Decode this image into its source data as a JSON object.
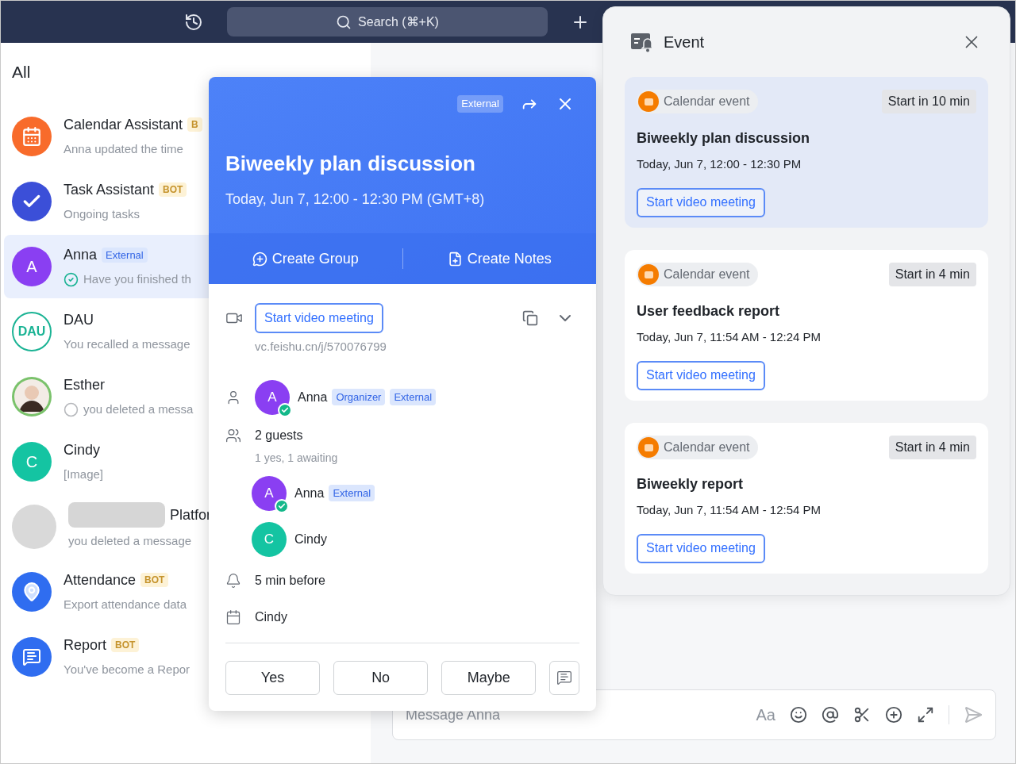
{
  "topbar": {
    "search": {
      "placeholder": "Search (⌘+K)"
    }
  },
  "sidebar": {
    "title": "All",
    "chats": [
      {
        "name": "Calendar Assistant",
        "badge": "B",
        "preview": "Anna updated the time",
        "selected": false,
        "avatar": {
          "kind": "calendar",
          "color": "#f86b2b"
        }
      },
      {
        "name": "Task Assistant",
        "badge": "BOT",
        "preview": "Ongoing tasks",
        "selected": false,
        "avatar": {
          "kind": "task",
          "color": "#3b4fd8"
        }
      },
      {
        "name": "Anna",
        "tag": "External",
        "preview": "Have you finished th",
        "read": true,
        "selected": true,
        "avatar": {
          "kind": "letter",
          "letter": "A",
          "color": "#8a3ff2"
        }
      },
      {
        "name": "DAU",
        "preview": "You recalled a message",
        "selected": false,
        "avatar": {
          "kind": "text",
          "letter": "DAU",
          "color": "#1ab394"
        }
      },
      {
        "name": "Esther",
        "preview": "you deleted a messa",
        "read": false,
        "selected": false,
        "avatar": {
          "kind": "person",
          "color": "#7ac26b"
        }
      },
      {
        "name": "Cindy",
        "preview": "[Image]",
        "selected": false,
        "avatar": {
          "kind": "letter",
          "letter": "C",
          "color": "#14c4a2"
        }
      },
      {
        "name": "Platfor",
        "redacted": true,
        "preview": "you deleted a message",
        "selected": false,
        "avatar": {
          "kind": "blank",
          "color": "#d9d9d9"
        }
      },
      {
        "name": "Attendance",
        "badge": "BOT",
        "preview": "Export attendance data",
        "selected": false,
        "avatar": {
          "kind": "pin",
          "color": "#2f6df0"
        }
      },
      {
        "name": "Report",
        "badge": "BOT",
        "preview": "You've become a Repor",
        "selected": false,
        "avatar": {
          "kind": "report",
          "color": "#2f6df0"
        }
      }
    ]
  },
  "popup": {
    "tag": "External",
    "title": "Biweekly plan discussion",
    "time": "Today, Jun 7, 12:00 - 12:30 PM (GMT+8)",
    "actions": [
      {
        "kind": "group",
        "label": "Create Group"
      },
      {
        "kind": "notes",
        "label": "Create Notes"
      }
    ],
    "meeting": {
      "button": "Start video meeting",
      "link": "vc.feishu.cn/j/570076799"
    },
    "organizer": {
      "letter": "A",
      "name": "Anna",
      "color": "#8a3ff2",
      "accepted": true,
      "tags": [
        "Organizer",
        "External"
      ]
    },
    "guests": {
      "count": "2 guests",
      "summary": "1 yes, 1 awaiting",
      "list": [
        {
          "letter": "A",
          "name": "Anna",
          "color": "#8a3ff2",
          "accepted": true,
          "tags": [
            "External"
          ]
        },
        {
          "letter": "C",
          "name": "Cindy",
          "color": "#14c4a2",
          "accepted": false
        }
      ]
    },
    "reminder": "5 min before",
    "calendar": "Cindy",
    "rsvp": [
      "Yes",
      "No",
      "Maybe"
    ]
  },
  "event_panel": {
    "title": "Event",
    "events": [
      {
        "source": "Calendar event",
        "countdown": "Start in 10 min",
        "title": "Biweekly plan discussion",
        "time": "Today, Jun 7, 12:00 - 12:30 PM",
        "button": "Start video meeting",
        "selected": true
      },
      {
        "source": "Calendar event",
        "countdown": "Start in 4 min",
        "title": "User feedback report",
        "time": "Today, Jun 7, 11:54 AM - 12:24 PM",
        "button": "Start video meeting",
        "selected": false
      },
      {
        "source": "Calendar event",
        "countdown": "Start in 4 min",
        "title": "Biweekly report",
        "time": "Today, Jun 7, 11:54 AM - 12:54 PM",
        "button": "Start video meeting",
        "selected": false
      }
    ]
  },
  "composer": {
    "placeholder": "Message Anna",
    "format_label": "Aa"
  }
}
